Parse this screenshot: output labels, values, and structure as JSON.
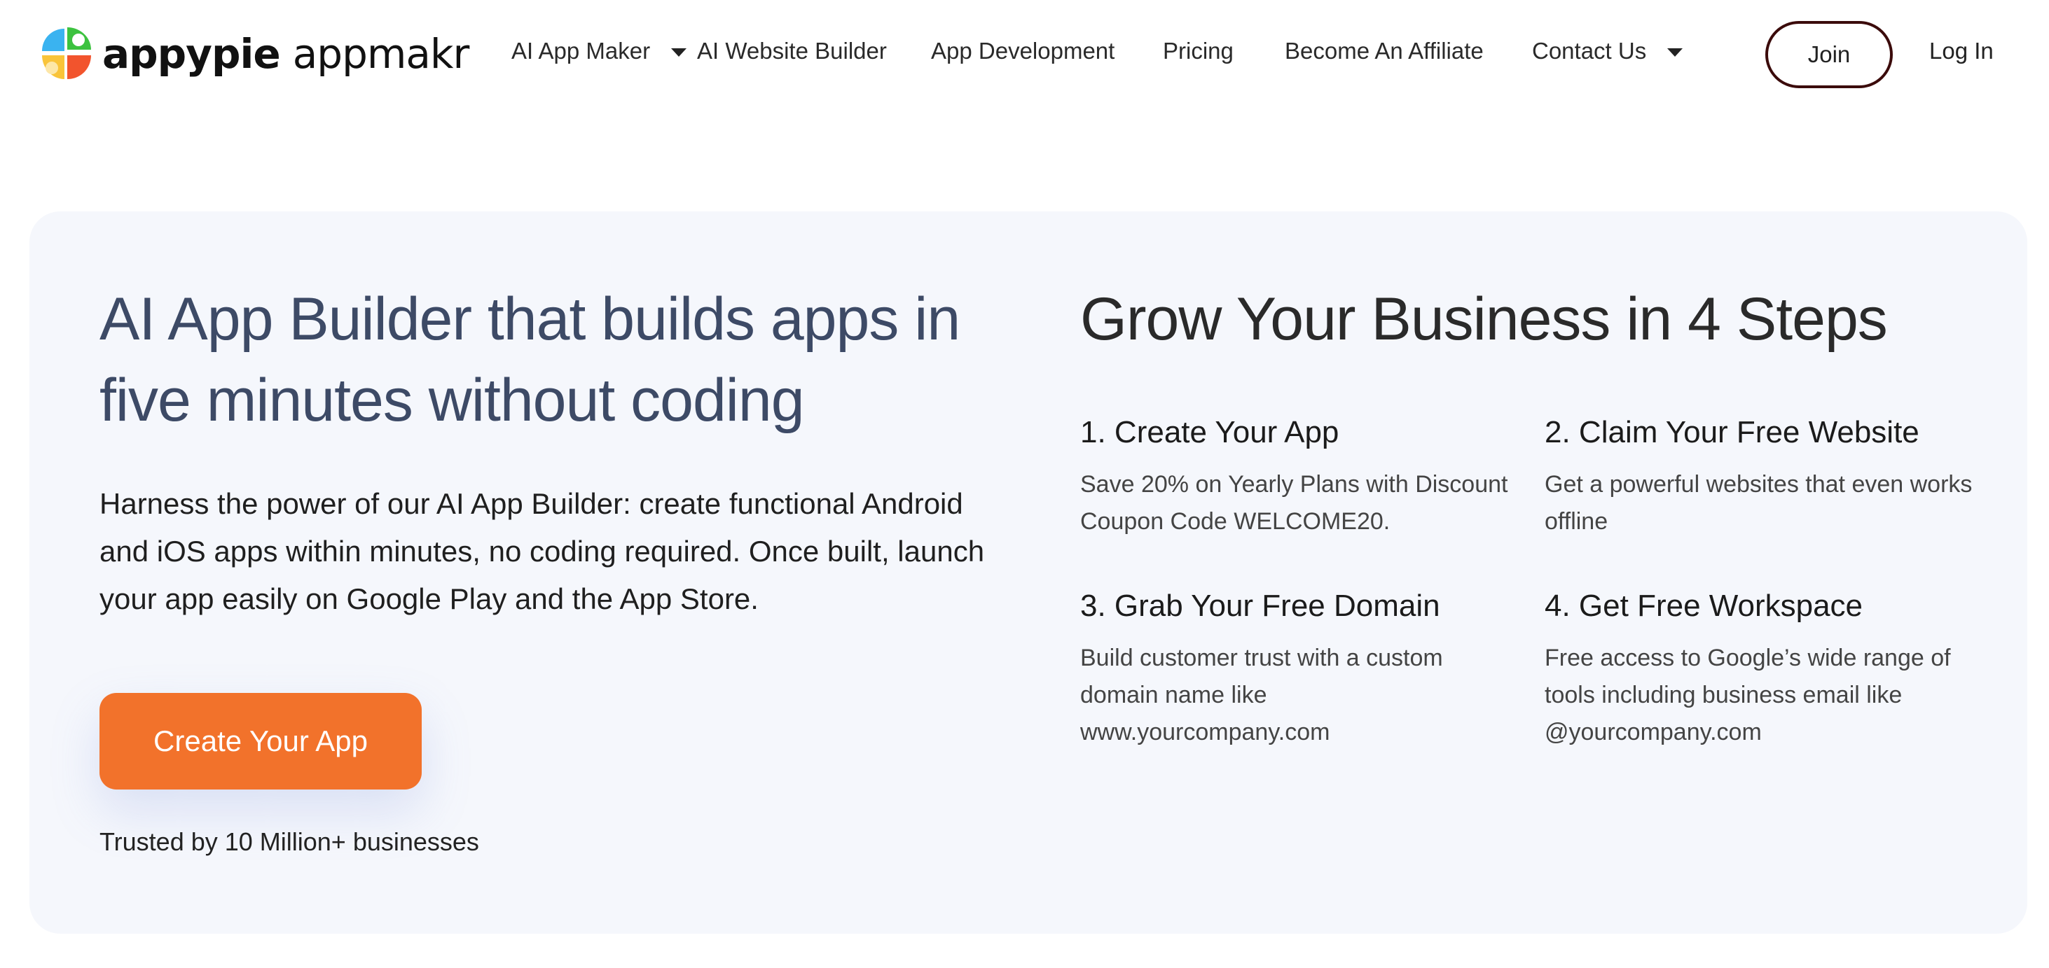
{
  "header": {
    "logo": {
      "brand": "appypie",
      "product": "appmakr"
    },
    "nav": [
      {
        "label": "AI App Maker",
        "has_dropdown": true
      },
      {
        "label": "AI Website Builder",
        "has_dropdown": false
      },
      {
        "label": "App Development",
        "has_dropdown": false
      },
      {
        "label": "Pricing",
        "has_dropdown": false
      },
      {
        "label": "Become An Affiliate",
        "has_dropdown": false
      },
      {
        "label": "Contact Us",
        "has_dropdown": true
      }
    ],
    "join_label": "Join",
    "login_label": "Log In"
  },
  "hero": {
    "title": "AI App Builder that builds apps in five minutes without coding",
    "description": "Harness the power of our AI App Builder: create functional Android and iOS apps within minutes, no coding required. Once built, launch your app easily on Google Play and the App Store.",
    "cta_label": "Create Your App",
    "trusted_text": "Trusted by 10 Million+ businesses"
  },
  "steps": {
    "title": "Grow Your Business in 4 Steps",
    "items": [
      {
        "title": "1. Create Your App",
        "description": "Save 20% on Yearly Plans with Discount Coupon Code WELCOME20."
      },
      {
        "title": "2. Claim Your Free Website",
        "description": "Get a powerful websites that even works offline"
      },
      {
        "title": "3. Grab Your Free Domain",
        "description": "Build customer trust with a custom domain name like www.yourcompany.com"
      },
      {
        "title": "4. Get Free Workspace",
        "description": "Free access to Google’s wide range of tools including business email like @yourcompany.com"
      }
    ]
  },
  "colors": {
    "accent": "#f2722b",
    "hero_bg": "#f5f7fc",
    "title_text": "#3d4a66",
    "join_border": "#3b0b0b"
  }
}
